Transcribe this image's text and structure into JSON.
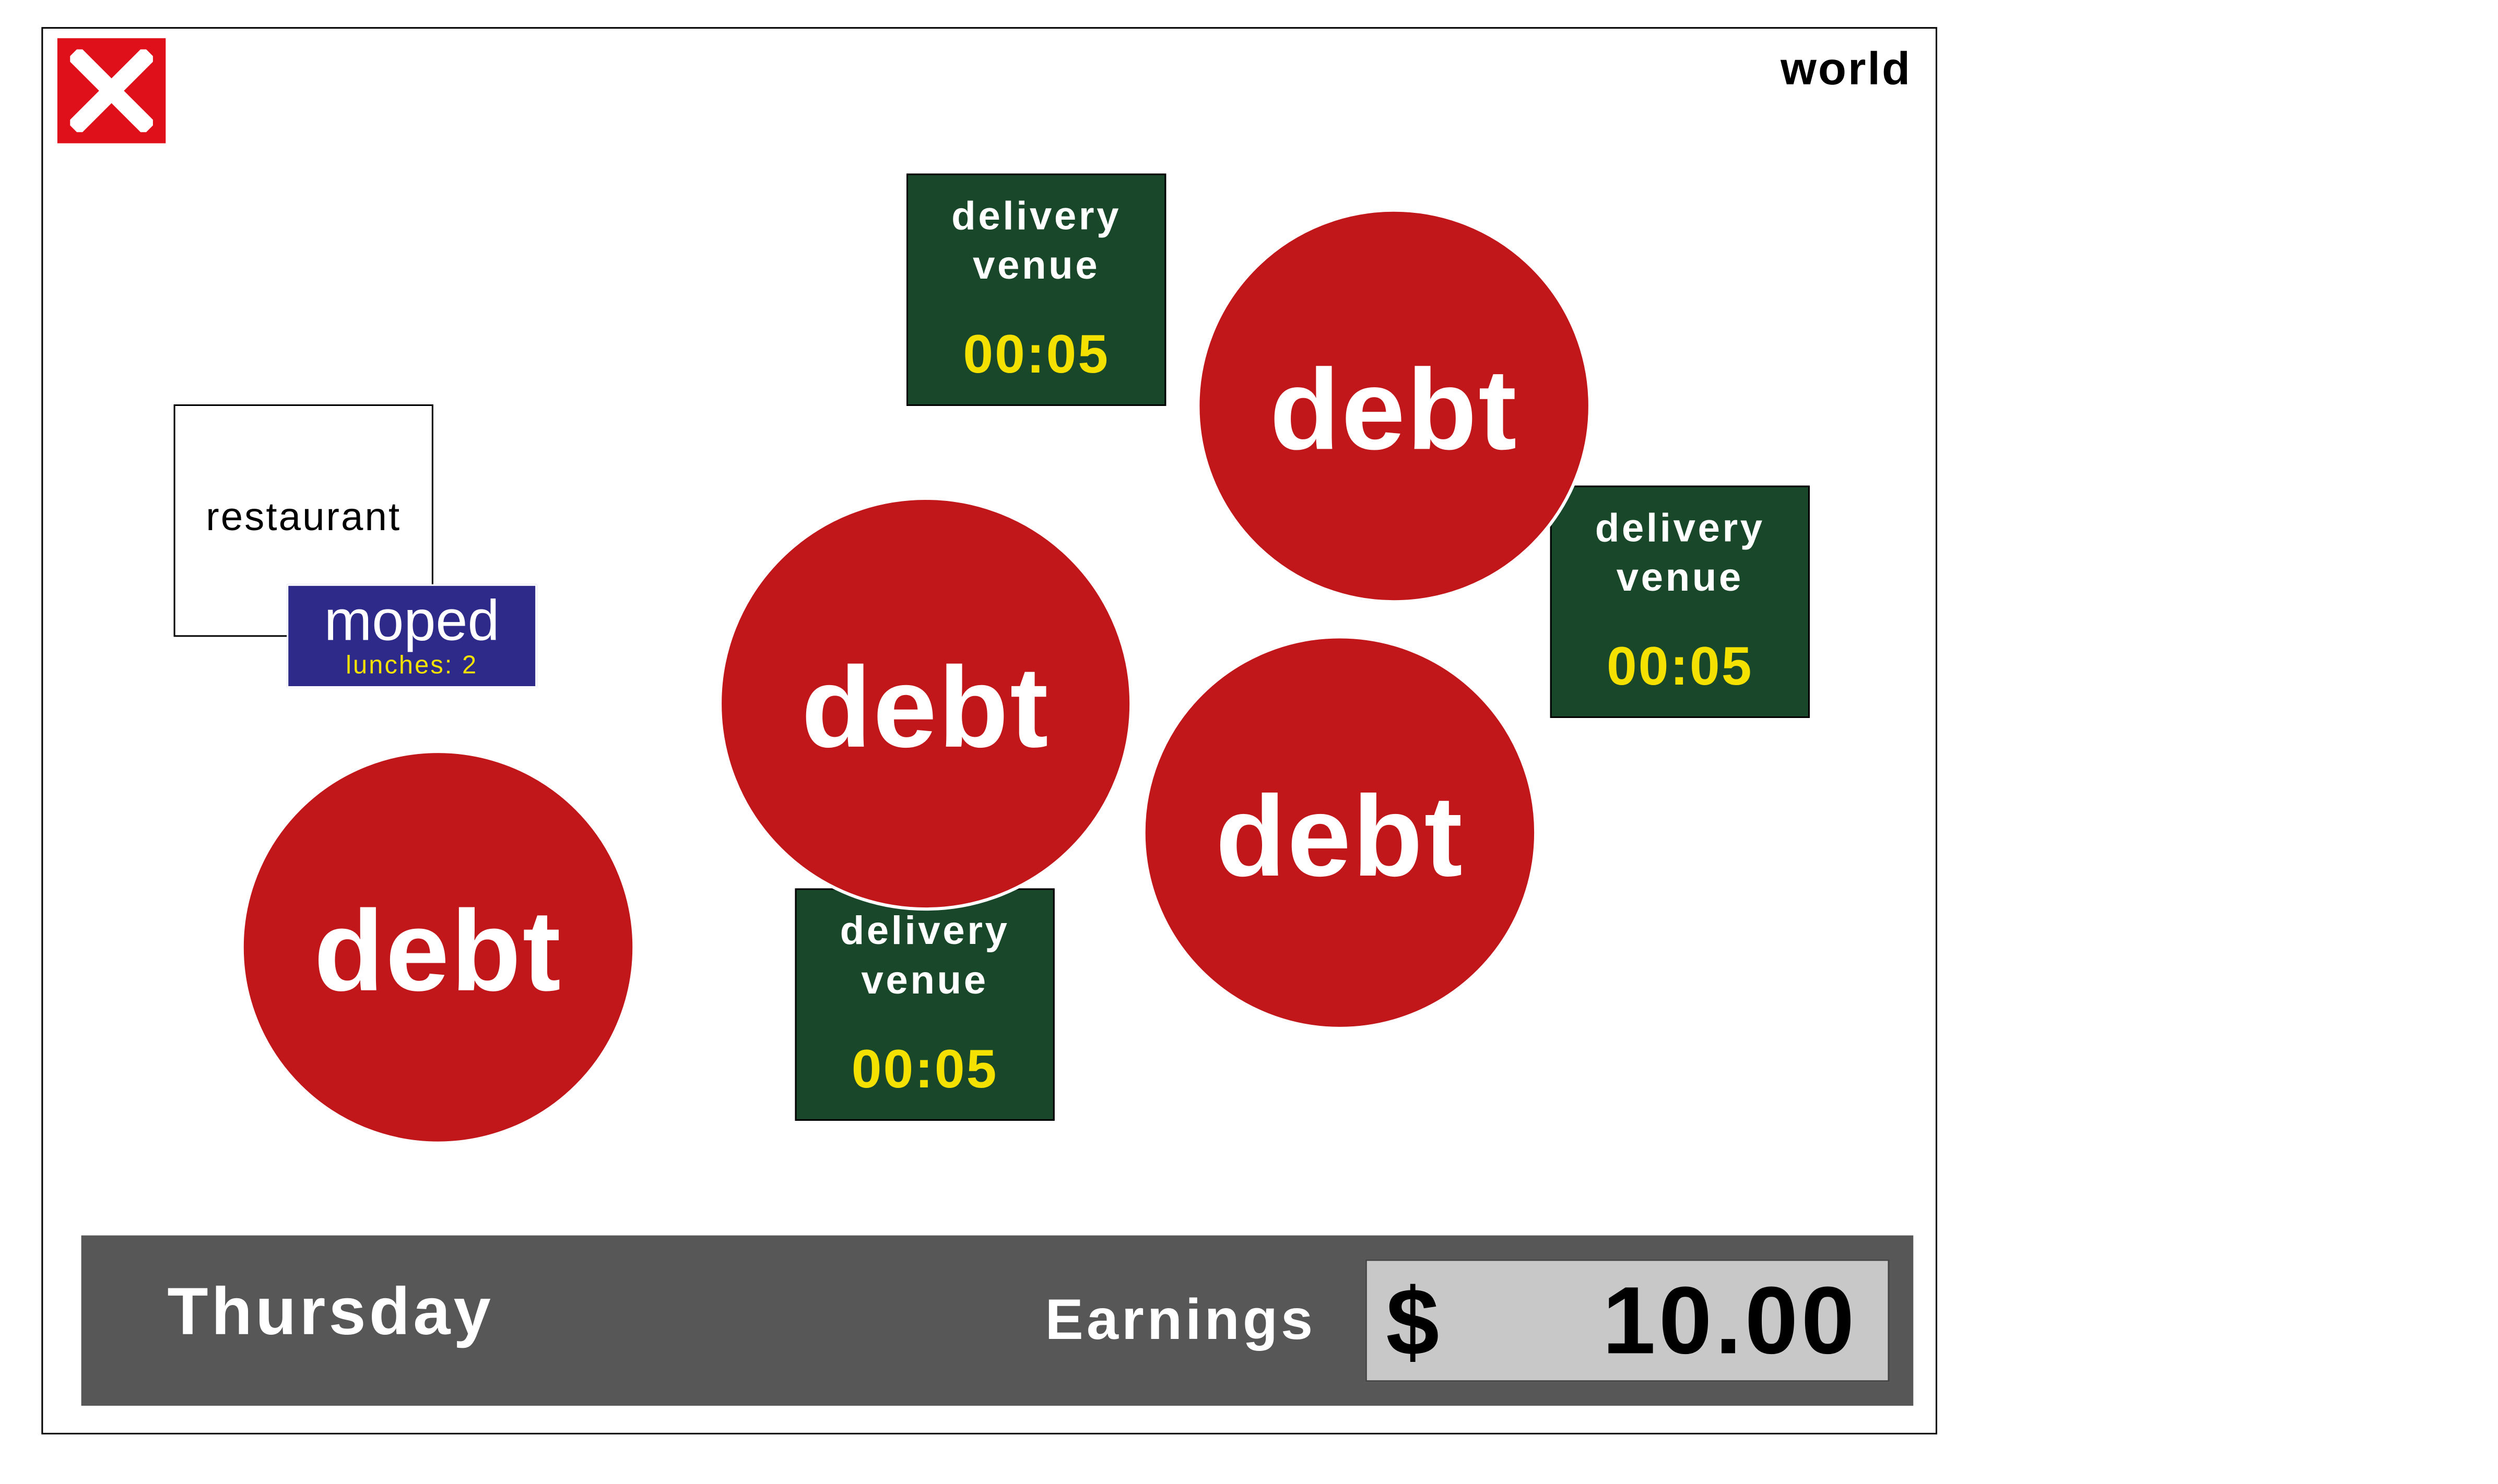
{
  "header": {
    "world_label": "world",
    "close_icon": "close-x-icon"
  },
  "colors": {
    "close": "#e0101a",
    "debt": "#c2171a",
    "venue": "#19472a",
    "timer": "#f5e100",
    "moped": "#2e2a8a",
    "bar": "#575757",
    "earnings_box": "#c8c8c8"
  },
  "restaurant": {
    "label": "restaurant"
  },
  "moped": {
    "label": "moped",
    "lunches": "lunches: 2"
  },
  "debts": [
    "debt",
    "debt",
    "debt",
    "debt"
  ],
  "venues": [
    {
      "line1": "delivery",
      "line2": "venue",
      "timer": "00:05"
    },
    {
      "line1": "delivery",
      "line2": "venue",
      "timer": "00:05"
    },
    {
      "line1": "delivery",
      "line2": "venue",
      "timer": "00:05"
    }
  ],
  "status": {
    "day": "Thursday",
    "earnings_label": "Earnings",
    "currency": "$",
    "earnings_value": "10.00"
  }
}
